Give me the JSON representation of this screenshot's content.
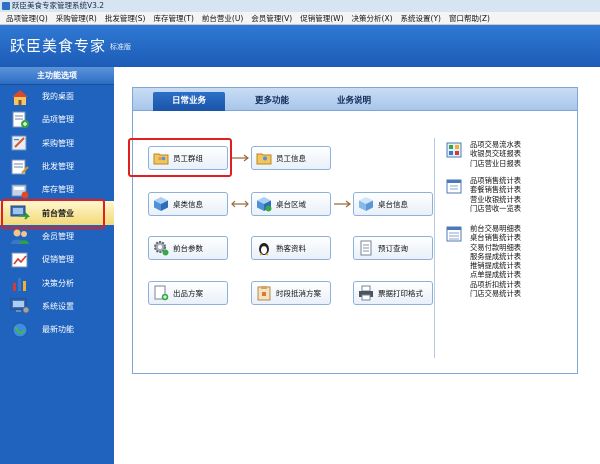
{
  "window": {
    "title": "跃臣美食专家管理系统V3.2"
  },
  "menubar": [
    "品项管理(Q)",
    "采购管理(R)",
    "批发管理(S)",
    "库存管理(T)",
    "前台营业(U)",
    "会员管理(V)",
    "促销管理(W)",
    "决策分析(X)",
    "系统设置(Y)",
    "窗口帮助(Z)"
  ],
  "header": {
    "app_name": "跃臣美食专家",
    "edition": "标准版"
  },
  "sidebar": {
    "title": "主功能选项",
    "items": [
      {
        "label": "我的桌面",
        "icon": "house-icon"
      },
      {
        "label": "品项管理",
        "icon": "items-icon"
      },
      {
        "label": "采购管理",
        "icon": "purchase-icon"
      },
      {
        "label": "批发管理",
        "icon": "wholesale-icon"
      },
      {
        "label": "库存管理",
        "icon": "inventory-icon"
      },
      {
        "label": "前台营业",
        "icon": "frontdesk-icon"
      },
      {
        "label": "会员管理",
        "icon": "member-icon"
      },
      {
        "label": "促销管理",
        "icon": "promotion-icon"
      },
      {
        "label": "决策分析",
        "icon": "chart-icon"
      },
      {
        "label": "系统设置",
        "icon": "settings-icon"
      },
      {
        "label": "最新功能",
        "icon": "globe-icon"
      }
    ],
    "active_index": 5
  },
  "tabs": [
    "日常业务",
    "更多功能",
    "业务说明"
  ],
  "buttons": {
    "staff_group": "员工群组",
    "staff_info": "员工信息",
    "table_type": "桌类信息",
    "table_area": "桌台区域",
    "table_info": "桌台信息",
    "front_params": "前台参数",
    "taste": "熟客资料",
    "reservation": "预订查询",
    "dish_plan": "出品方案",
    "time_discount": "时段抵消方案",
    "receipt_format": "票据打印格式"
  },
  "reports": {
    "group1": [
      "品项交易流水表",
      "收银员交班报表",
      "门店营业日报表"
    ],
    "group2": [
      "品项销售统计表",
      "套餐销售统计表",
      "营业收银统计表",
      "门店营收一览表"
    ],
    "group3": [
      "前台交易明细表",
      "桌台销售统计表",
      "交易付款明细表",
      "服务提成统计表",
      "推销提成统计表",
      "点单提成统计表",
      "品项折扣统计表",
      "门店交易统计表"
    ]
  },
  "colors": {
    "accent": "#1f63bf",
    "highlight": "#e02020",
    "active_nav": "#f3d978"
  }
}
